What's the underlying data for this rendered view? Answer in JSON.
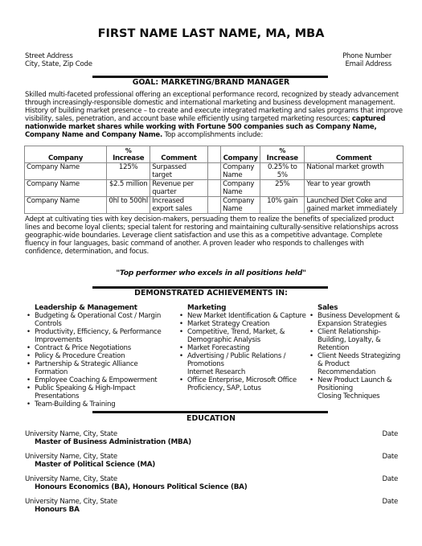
{
  "header": {
    "name": "FIRST NAME LAST NAME, MA, MBA",
    "street": "Street Address",
    "city": "City, State, Zip Code",
    "phone": "Phone Number",
    "email": "Email Address"
  },
  "goal": {
    "title": "GOAL:  MARKETING/BRAND MANAGER"
  },
  "summary": {
    "text_regular": "Skilled multi-faceted professional offering an exceptional performance record, recognized by steady advancement through increasingly-responsible domestic and international marketing and business development management. History of building market presence – to create and execute integrated marketing and sales programs that improve visibility, sales, penetration, and account base while efficiently using targeted marketing resources; ",
    "text_bold": "captured nationwide market shares while working with Fortune 500 companies such as Company Name, Company Name and Company Name.",
    "text_tail": " Top accomplishments include:"
  },
  "accomplishments": {
    "headers": {
      "company": "Company",
      "pct_symbol": "%",
      "increase": "Increase",
      "comment": "Comment"
    },
    "left": [
      {
        "company": "Company Name",
        "increase": "125%",
        "comment": "Surpassed target"
      },
      {
        "company": "Company Name",
        "increase": "$2.5 million",
        "comment": "Revenue per quarter"
      },
      {
        "company": "Company Name",
        "increase": "0hl to 500hl",
        "comment": "Increased export sales"
      }
    ],
    "right": [
      {
        "company": "Company Name",
        "increase": "0.25% to 5%",
        "comment": "National market growth"
      },
      {
        "company": "Company Name",
        "increase": "25%",
        "comment": "Year to year growth"
      },
      {
        "company": "Company Name",
        "increase": "10% gain",
        "comment": "Launched Diet Coke and gained market immediately"
      }
    ]
  },
  "paragraph2": "Adept at cultivating ties with key decision-makers, persuading them to realize the benefits of specialized product lines and become loyal clients; special talent for restoring and maintaining culturally-sensitive relationships across geographic-wide boundaries.  Leverage client satisfaction and use this as a competitive advantage.  Complete fluency in four languages, basic command of another.  A proven leader who responds to challenges with confidence, determination, and focus.",
  "quote": "\"Top performer who excels in all positions held\"",
  "achievements": {
    "title": "DEMONSTRATED ACHIEVEMENTS IN:",
    "bullet": "•",
    "columns": [
      {
        "heading": "Leadership & Management",
        "items": [
          {
            "text": "Budgeting & Operational Cost / Margin Controls",
            "bullet": true
          },
          {
            "text": "Productivity, Efficiency, & Performance Improvements",
            "bullet": true
          },
          {
            "text": "Contract & Price Negotiations",
            "bullet": true
          },
          {
            "text": "Policy & Procedure Creation",
            "bullet": true
          },
          {
            "text": "Partnership & Strategic Alliance Formation",
            "bullet": true
          },
          {
            "text": "Employee Coaching & Empowerment",
            "bullet": true
          },
          {
            "text": "Public Speaking & High-Impact Presentations",
            "bullet": true
          },
          {
            "text": "Team-Building & Training",
            "bullet": true
          }
        ]
      },
      {
        "heading": "Marketing",
        "items": [
          {
            "text": "New Market Identification & Capture",
            "bullet": true
          },
          {
            "text": "Market Strategy Creation",
            "bullet": true
          },
          {
            "text": "Competitive, Trend, Market, & Demographic Analysis",
            "bullet": true
          },
          {
            "text": "Market Forecasting",
            "bullet": true
          },
          {
            "text": "Advertising / Public Relations / Promotions",
            "bullet": true
          },
          {
            "text": "Internet Research",
            "bullet": false
          },
          {
            "text": "Office Enterprise, Microsoft Office Proficiency, SAP, Lotus",
            "bullet": true
          }
        ]
      },
      {
        "heading": "Sales",
        "items": [
          {
            "text": "Business Development & Expansion Strategies",
            "bullet": true
          },
          {
            "text": "Client Relationship-Building, Loyalty, & Retention",
            "bullet": true
          },
          {
            "text": "Client Needs Strategizing & Product Recommendation",
            "bullet": true
          },
          {
            "text": "New Product Launch & Positioning",
            "bullet": true
          },
          {
            "text": "Closing Techniques",
            "bullet": false
          }
        ]
      }
    ]
  },
  "education": {
    "title": "EDUCATION",
    "entries": [
      {
        "school": "University Name, City, State",
        "date": "Date",
        "degree": "Master of Business Administration (MBA)"
      },
      {
        "school": "University Name, City, State",
        "date": "Date",
        "degree": "Master of Political Science (MA)"
      },
      {
        "school": "University Name, City, State",
        "date": "Date",
        "degree": "Honours Economics (BA), Honours Political Science (BA)"
      },
      {
        "school": "University Name, City, State",
        "date": "Date",
        "degree": "Honours BA"
      }
    ]
  }
}
